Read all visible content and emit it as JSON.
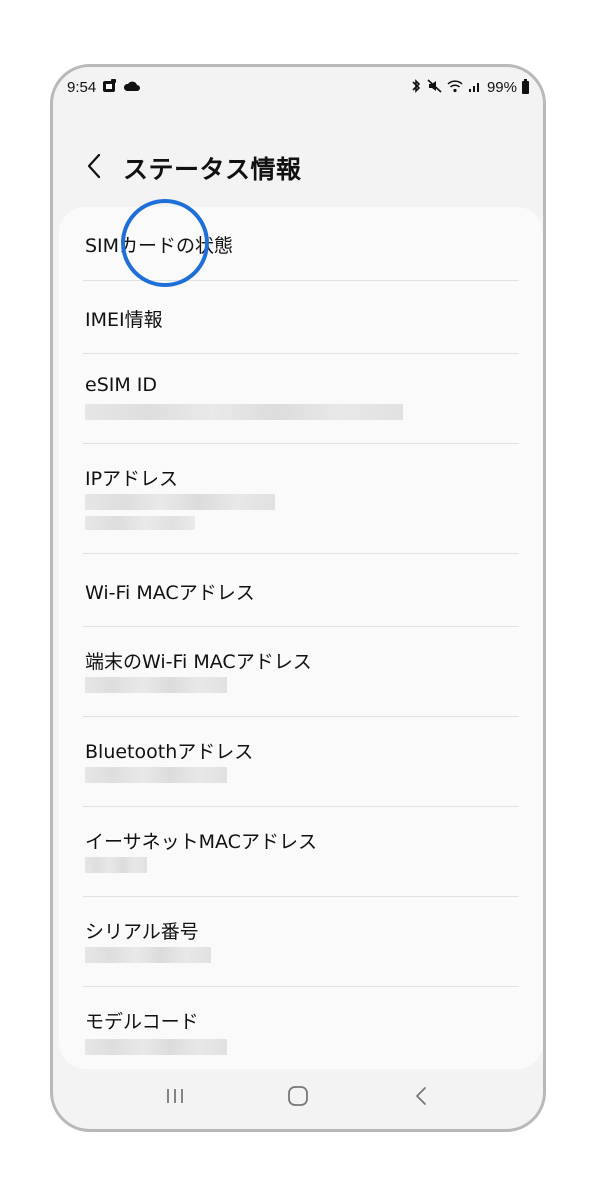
{
  "status_bar": {
    "time": "9:54",
    "left_icons": [
      "notification-app-icon",
      "cloud-icon"
    ],
    "right_icons": [
      "bluetooth-icon",
      "mute-icon",
      "wifi-icon",
      "signal-icon"
    ],
    "battery": "99%"
  },
  "header": {
    "back_icon": "chevron-left-icon",
    "title": "ステータス情報"
  },
  "items": [
    {
      "label": "SIMカードの状態",
      "has_value": false
    },
    {
      "label": "IMEI情報",
      "has_value": false
    },
    {
      "label": "eSIM ID",
      "has_value": true,
      "value_redacted": true
    },
    {
      "label": "IPアドレス",
      "has_value": true,
      "value_redacted": true
    },
    {
      "label": "Wi-Fi MACアドレス",
      "has_value": false
    },
    {
      "label": "端末のWi-Fi MACアドレス",
      "has_value": true,
      "value_redacted": true
    },
    {
      "label": "Bluetoothアドレス",
      "has_value": true,
      "value_redacted": true
    },
    {
      "label": "イーサネットMACアドレス",
      "has_value": true,
      "value_redacted": true
    },
    {
      "label": "シリアル番号",
      "has_value": true,
      "value_redacted": true
    },
    {
      "label": "モデルコード",
      "has_value": true,
      "value_redacted": true
    }
  ],
  "highlight": {
    "color": "#1f6fd8",
    "target": "SIMカードの状態"
  },
  "nav_bar": {
    "buttons": [
      "recent-apps-icon",
      "home-icon",
      "back-icon"
    ]
  },
  "colors": {
    "frame": "#b9b9b9",
    "background": "#f3f3f3",
    "card": "#fafafa",
    "divider": "#e1e1e1",
    "text": "#111111"
  }
}
